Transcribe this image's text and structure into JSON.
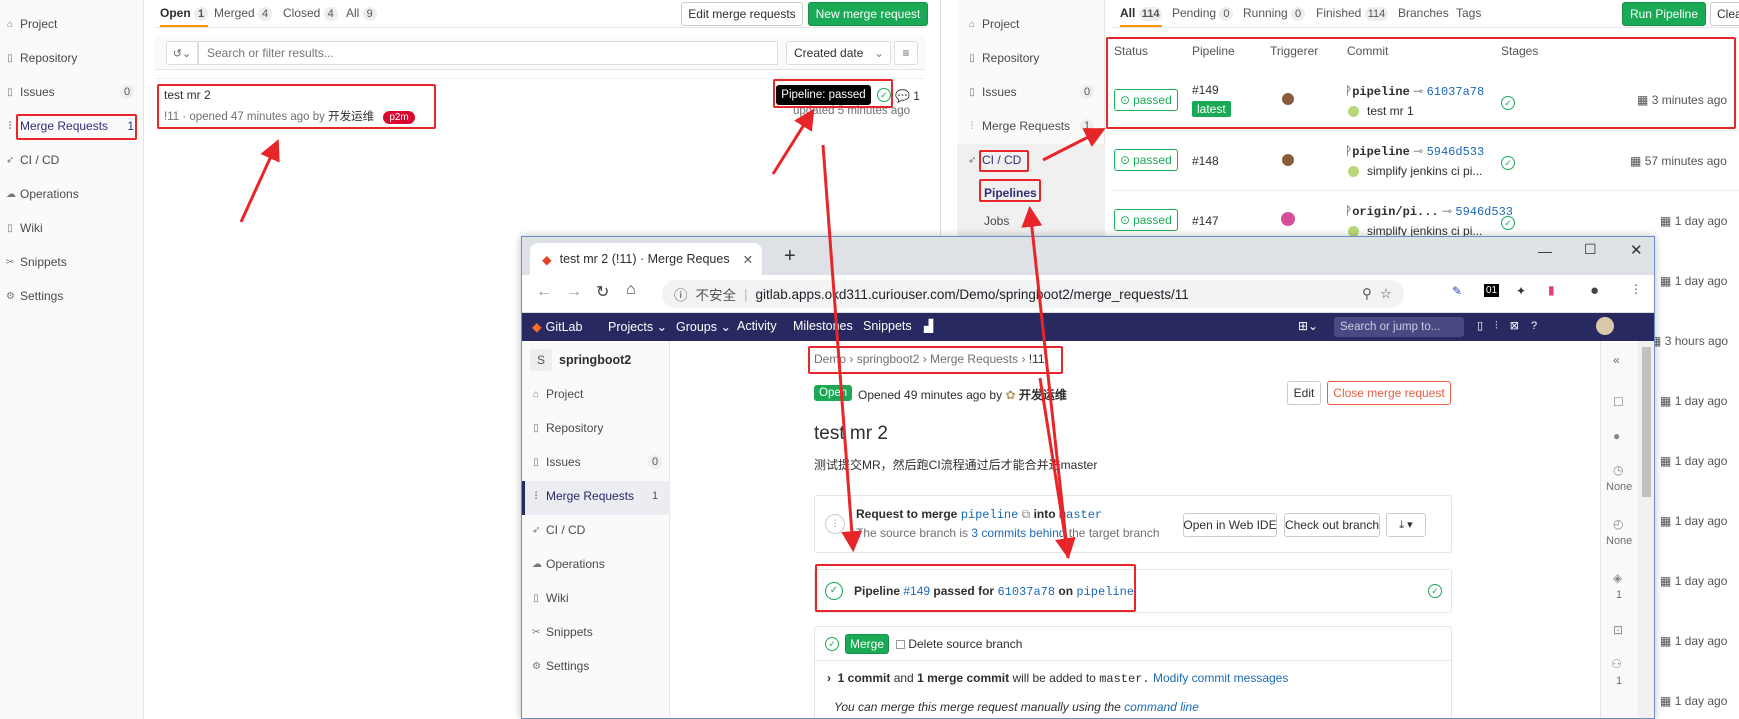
{
  "left_window": {
    "sidebar": [
      {
        "label": "Project",
        "icon": "home-icon"
      },
      {
        "label": "Repository",
        "icon": "doc-icon"
      },
      {
        "label": "Issues",
        "icon": "issues-icon",
        "count": "0"
      },
      {
        "label": "Merge Requests",
        "icon": "merge-icon",
        "count": "1"
      },
      {
        "label": "CI / CD",
        "icon": "rocket-icon"
      },
      {
        "label": "Operations",
        "icon": "cloud-icon"
      },
      {
        "label": "Wiki",
        "icon": "book-icon"
      },
      {
        "label": "Snippets",
        "icon": "scissors-icon"
      },
      {
        "label": "Settings",
        "icon": "gear-icon"
      }
    ],
    "tabs": [
      {
        "label": "Open",
        "count": "1"
      },
      {
        "label": "Merged",
        "count": "4"
      },
      {
        "label": "Closed",
        "count": "4"
      },
      {
        "label": "All",
        "count": "9"
      }
    ],
    "edit_button": "Edit merge requests",
    "new_button": "New merge request",
    "filter_placeholder": "Search or filter results...",
    "sort_label": "Created date",
    "mr": {
      "title": "test mr 2",
      "meta": "!11 · opened 47 minutes ago by",
      "author": "开发运维",
      "label": "p2m",
      "tooltip": "Pipeline: passed",
      "comments": "1",
      "updated": "updated 5 minutes ago"
    }
  },
  "right_window": {
    "sidebar": [
      {
        "label": "Project"
      },
      {
        "label": "Repository"
      },
      {
        "label": "Issues",
        "count": "0"
      },
      {
        "label": "Merge Requests",
        "count": "1"
      },
      {
        "label": "CI / CD"
      },
      {
        "label": "Pipelines"
      },
      {
        "label": "Jobs"
      }
    ],
    "tabs": [
      {
        "label": "All",
        "count": "114"
      },
      {
        "label": "Pending",
        "count": "0"
      },
      {
        "label": "Running",
        "count": "0"
      },
      {
        "label": "Finished",
        "count": "114"
      },
      {
        "label": "Branches"
      },
      {
        "label": "Tags"
      }
    ],
    "run_button": "Run Pipeline",
    "clear_button": "Clea",
    "columns": [
      "Status",
      "Pipeline",
      "Triggerer",
      "Commit",
      "Stages"
    ],
    "rows": [
      {
        "status": "passed",
        "id": "#149",
        "latest": "latest",
        "branch": "pipeline",
        "sha": "61037a78",
        "msg": "test mr 1",
        "time": "3 minutes ago"
      },
      {
        "status": "passed",
        "id": "#148",
        "branch": "pipeline",
        "sha": "5946d533",
        "msg": "simplify jenkins ci pi...",
        "time": "57 minutes ago"
      },
      {
        "status": "passed",
        "id": "#147",
        "branch": "origin/pi...",
        "sha": "5946d533",
        "msg": "simplify jenkins ci pi...",
        "time": "1 day ago"
      }
    ],
    "extra_times": [
      "1 day ago",
      "3 hours ago",
      "1 day ago",
      "1 day ago",
      "1 day ago",
      "1 day ago",
      "1 day ago",
      "1 day ago"
    ]
  },
  "browser": {
    "tab_title": "test mr 2 (!11) · Merge Reques",
    "new_tab": "+",
    "insecure": "不安全",
    "url": "gitlab.apps.okd311.curiouser.com/Demo/springboot2/merge_requests/11",
    "nav": {
      "logo": "GitLab",
      "items": [
        "Projects",
        "Groups",
        "Activity",
        "Milestones",
        "Snippets"
      ],
      "search_placeholder": "Search or jump to..."
    },
    "project_initial": "S",
    "project_name": "springboot2",
    "sidebar": [
      {
        "label": "Project"
      },
      {
        "label": "Repository"
      },
      {
        "label": "Issues",
        "count": "0"
      },
      {
        "label": "Merge Requests",
        "count": "1"
      },
      {
        "label": "CI / CD"
      },
      {
        "label": "Operations"
      },
      {
        "label": "Wiki"
      },
      {
        "label": "Snippets"
      },
      {
        "label": "Settings"
      }
    ],
    "breadcrumb": [
      "Demo",
      "springboot2",
      "Merge Requests",
      "!11"
    ],
    "status_badge": "Open",
    "opened_text": "Opened 49 minutes ago by",
    "author": "开发运维",
    "edit_button": "Edit",
    "close_button": "Close merge request",
    "title": "test mr 2",
    "description": "测试提交MR，然后跑CI流程通过后才能合并进master",
    "request": {
      "prefix": "Request to merge",
      "source": "pipeline",
      "into": "into",
      "target": "master",
      "sub_prefix": "The source branch is",
      "sub_link": "3 commits behind",
      "sub_suffix": "the target branch",
      "web_ide": "Open in Web IDE",
      "checkout": "Check out branch"
    },
    "pipeline": {
      "prefix": "Pipeline",
      "id": "#149",
      "passed_for": "passed for",
      "sha": "61037a78",
      "on": "on",
      "branch": "pipeline"
    },
    "merge": {
      "button": "Merge",
      "delete_label": "Delete source branch",
      "info_c1": "1 commit",
      "info_and": "and",
      "info_c2": "1 merge commit",
      "info_rest": "will be added to",
      "info_branch": "master.",
      "info_link": "Modify commit messages",
      "manual_prefix": "You can merge this merge request manually using the",
      "manual_link": "command line"
    },
    "right_rail": {
      "none1": "None",
      "none2": "None",
      "count1": "1",
      "count2": "1"
    }
  },
  "colors": {
    "accent": "#1aaa55",
    "nav": "#292961",
    "annotation": "#e8262a",
    "link": "#1b69b6"
  }
}
